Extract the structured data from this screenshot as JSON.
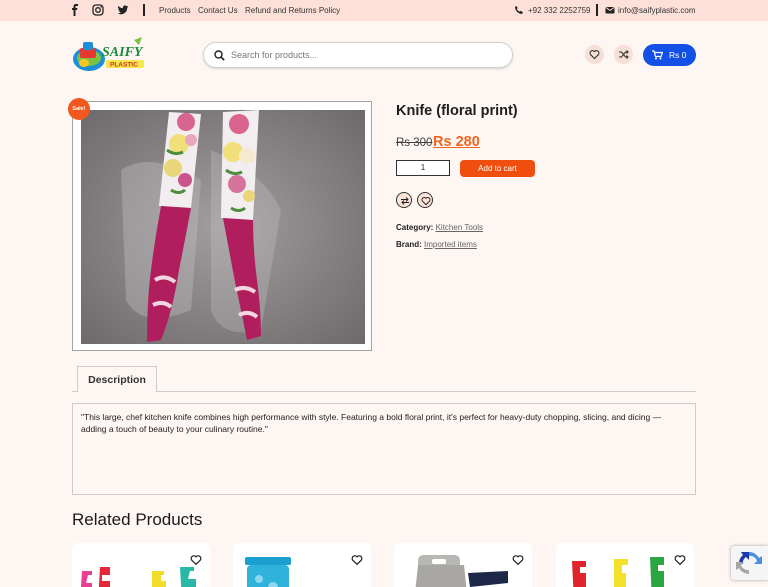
{
  "topbar": {
    "links": [
      "Products",
      "Contact Us",
      "Refund and Returns Policy"
    ],
    "phone": "+92 332 2252759",
    "email": "info@saifyplastic.com"
  },
  "header": {
    "logo_text": "SAIFY PLASTIC",
    "search_placeholder": "Search for products...",
    "cart_label": "Rs 0"
  },
  "product": {
    "sale_badge": "Sale!",
    "title": "Knife (floral print)",
    "price_old": "Rs 300",
    "price_new": "Rs 280",
    "quantity": "1",
    "add_to_cart": "Add to cart",
    "category_label": "Category:",
    "category_value": "Kitchen Tools",
    "brand_label": "Brand:",
    "brand_value": "Imported items"
  },
  "tabs": [
    {
      "label": "Description"
    }
  ],
  "description": "\"This large, chef kitchen knife combines high performance with style. Featuring a bold floral print, it's perfect for heavy-duty chopping, slicing, and dicing — adding a touch of beauty to your culinary routine.\"",
  "related": {
    "heading": "Related Products",
    "cards": [
      {
        "icon": "heart-icon"
      },
      {
        "icon": "heart-icon"
      },
      {
        "icon": "heart-icon"
      },
      {
        "icon": "heart-icon"
      }
    ]
  },
  "colors": {
    "accent": "#f06521",
    "cart_blue": "#1250e6",
    "topbar_bg": "#fde1d8",
    "page_bg": "#fdf6f2"
  }
}
